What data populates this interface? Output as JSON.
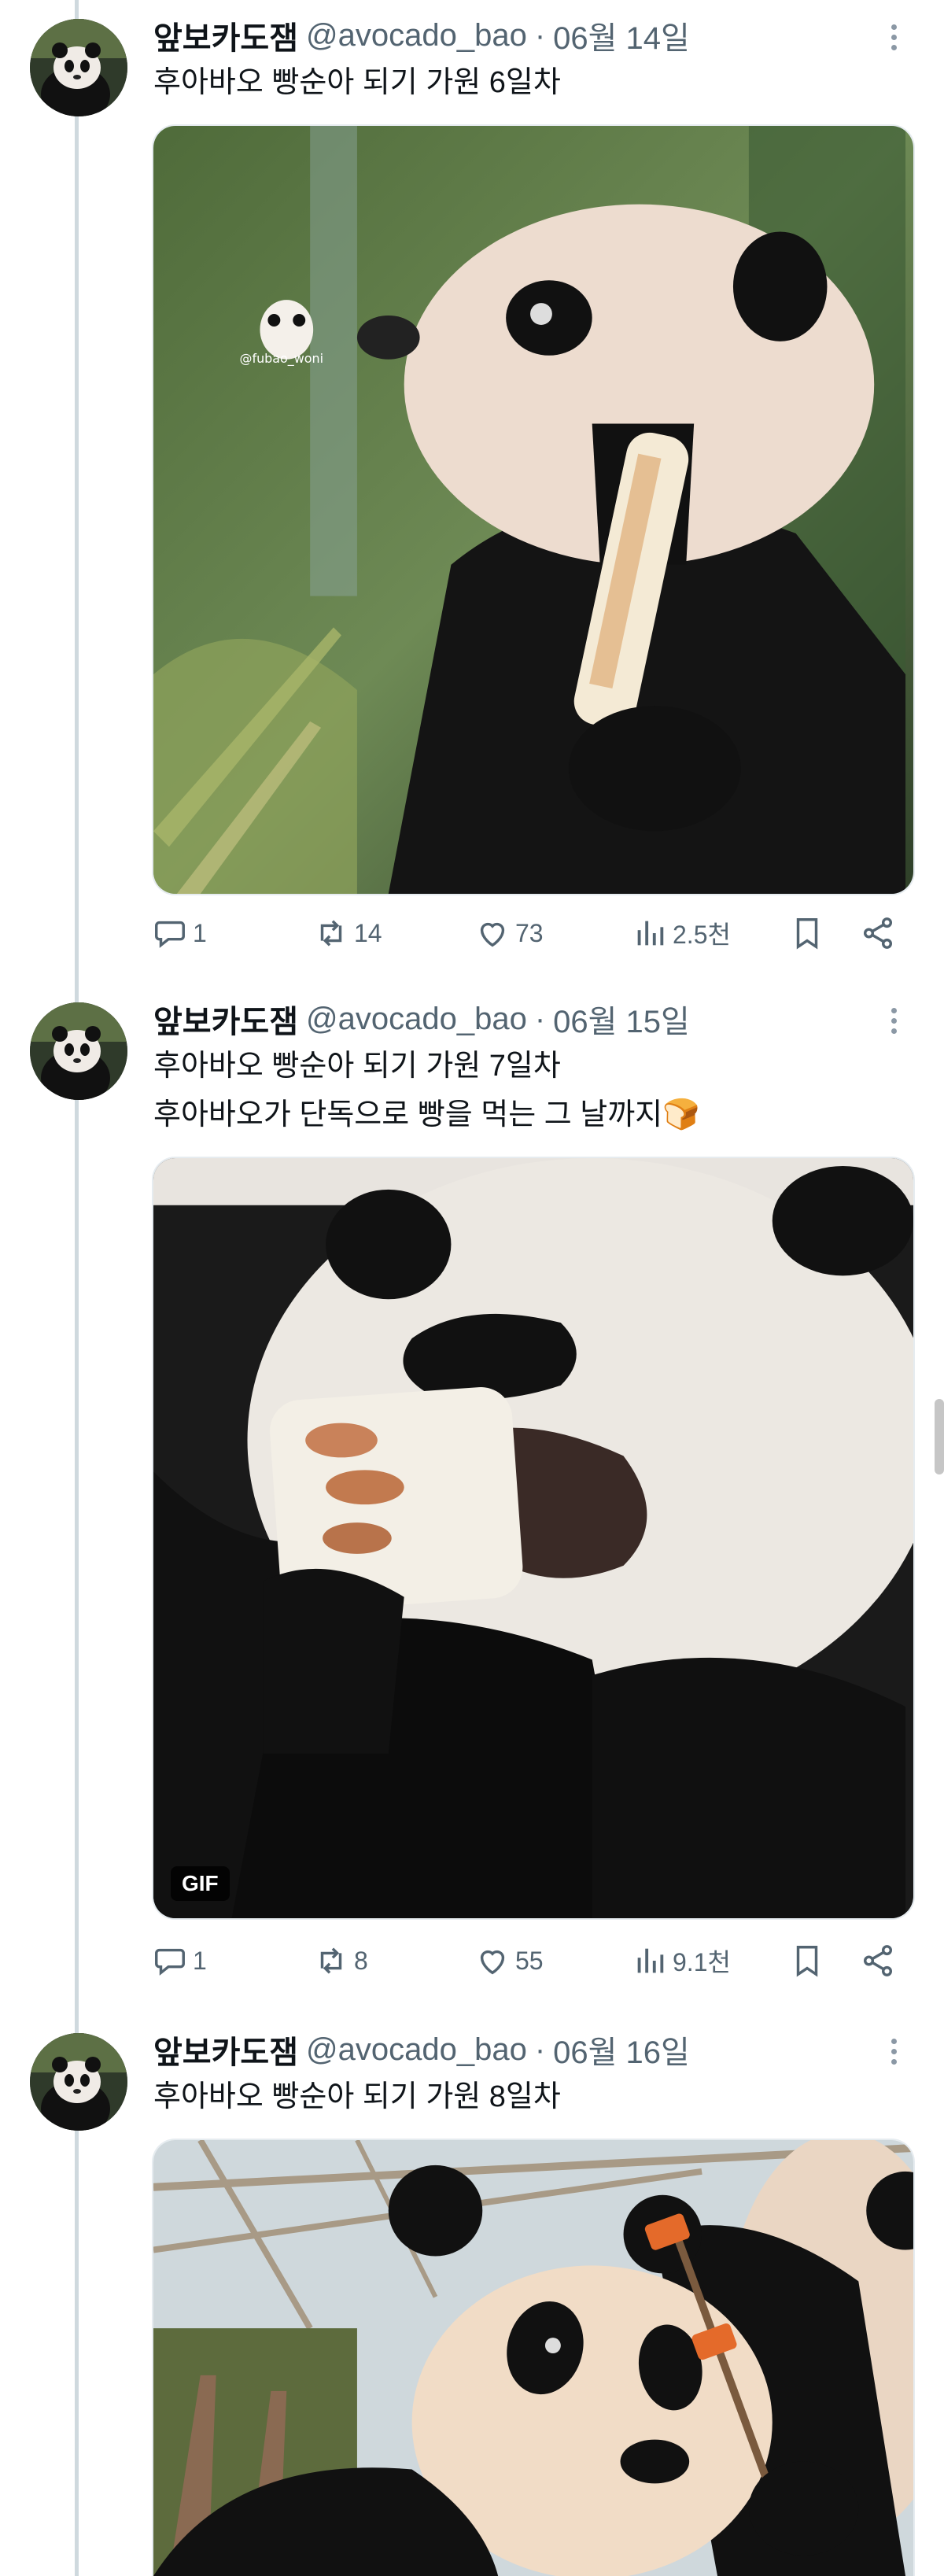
{
  "tweets": [
    {
      "author_name": "앞보카도잼",
      "handle": "@avocado_bao",
      "separator": "·",
      "date": "06월 14일",
      "lines": [
        "후아바오 빵순아 되기 가원 6일차"
      ],
      "media": {
        "type": "image",
        "watermark": "@fubao_woni"
      },
      "stats": {
        "replies": "1",
        "retweets": "14",
        "likes": "73",
        "views": "2.5천"
      }
    },
    {
      "author_name": "앞보카도잼",
      "handle": "@avocado_bao",
      "separator": "·",
      "date": "06월 15일",
      "lines": [
        "후아바오 빵순아 되기 가원 7일차",
        "후아바오가 단독으로 빵을 먹는 그 날까지🍞"
      ],
      "media": {
        "type": "gif",
        "badge": "GIF"
      },
      "stats": {
        "replies": "1",
        "retweets": "8",
        "likes": "55",
        "views": "9.1천"
      }
    },
    {
      "author_name": "앞보카도잼",
      "handle": "@avocado_bao",
      "separator": "·",
      "date": "06월 16일",
      "lines": [
        "후아바오 빵순아 되기 가원 8일차"
      ],
      "media": {
        "type": "image"
      },
      "stats": {}
    }
  ],
  "icons": {
    "reply": "comment-icon",
    "retweet": "retweet-icon",
    "like": "heart-icon",
    "views": "analytics-icon",
    "bookmark": "bookmark-icon",
    "share": "share-icon",
    "more": "more-options-icon"
  },
  "colors": {
    "text": "#0f1419",
    "secondary": "#536471",
    "thread_line": "#cfd9de"
  }
}
